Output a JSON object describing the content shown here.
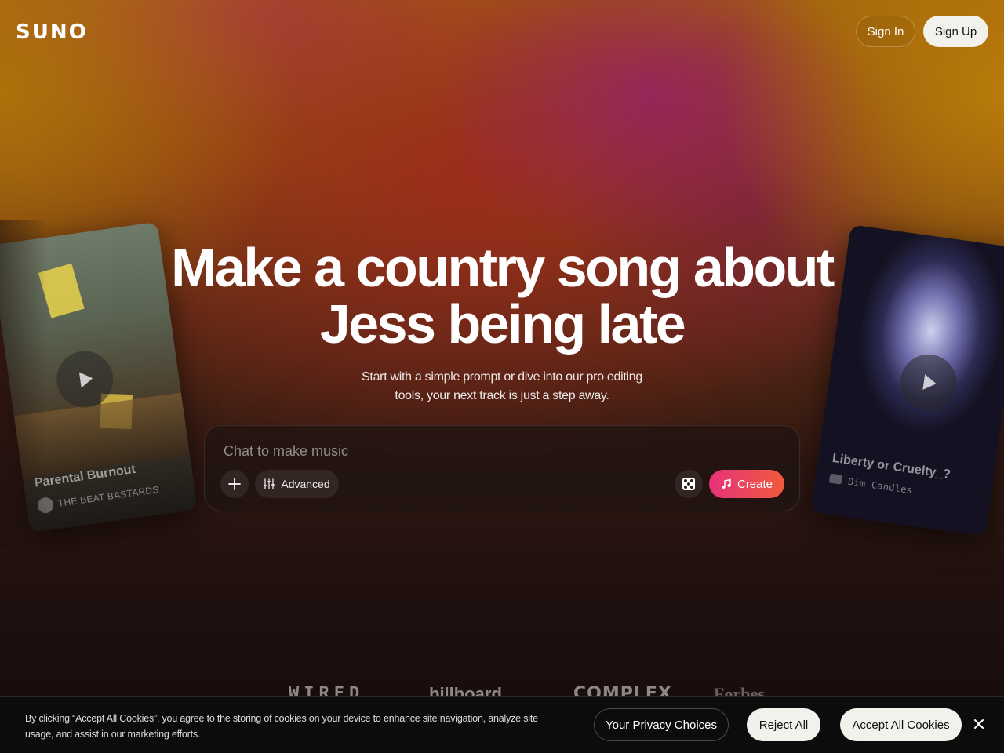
{
  "header": {
    "logo": "SUNO",
    "sign_in": "Sign In",
    "sign_up": "Sign Up"
  },
  "hero": {
    "title_line1": "Make a country song about",
    "title_line2": "Jess being late",
    "subtitle_line1": "Start with a simple prompt or dive into our pro editing",
    "subtitle_line2": "tools, your next track is just a step away."
  },
  "chat": {
    "placeholder": "Chat to make music",
    "advanced_label": "Advanced",
    "create_label": "Create"
  },
  "cards": [
    {
      "title": "Parental Burnout",
      "artist": "THE BEAT BASTARDS"
    },
    {
      "title": "Liberty or Cruelty_?",
      "artist": "Dim Candles"
    }
  ],
  "press_logos": [
    "",
    "WIRED",
    "billboard",
    "COMPLEX",
    "Forbes"
  ],
  "cookie_banner": {
    "text_line1": "By clicking “Accept All Cookies”, you agree to the storing of cookies on your device to enhance site navigation, analyze site",
    "text_line2": "usage, and assist in our marketing efforts.",
    "privacy_choices": "Your Privacy Choices",
    "reject_all": "Reject All",
    "accept_all": "Accept All Cookies"
  },
  "colors": {
    "create_gradient_start": "#e8327a",
    "create_gradient_end": "#ef5a3c",
    "button_light": "#f3f1ec"
  }
}
